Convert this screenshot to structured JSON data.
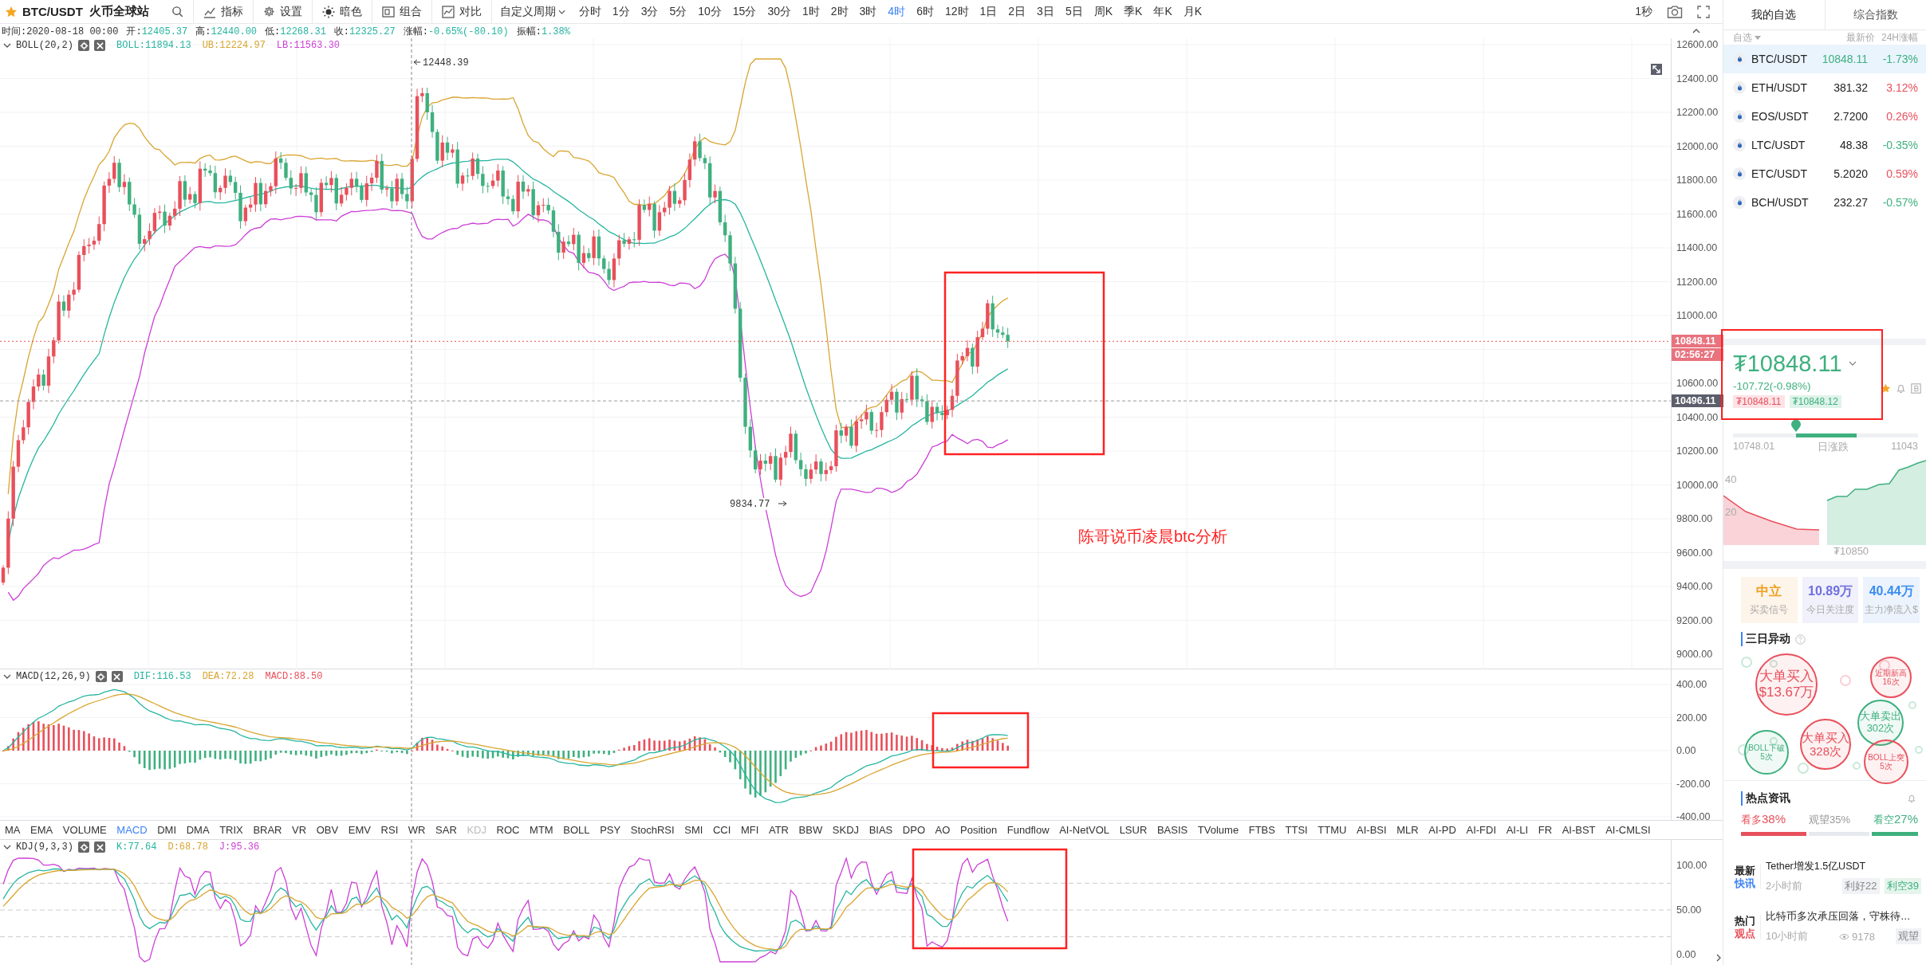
{
  "symbol": {
    "pair": "BTC/USDT",
    "exchange": "火币全球站"
  },
  "tools": [
    {
      "kind": "indicator",
      "label": "指标"
    },
    {
      "kind": "settings",
      "label": "设置"
    },
    {
      "kind": "theme",
      "label": "暗色"
    },
    {
      "kind": "layout",
      "label": "组合"
    },
    {
      "kind": "compare",
      "label": "对比"
    }
  ],
  "period_menu": "自定义周期",
  "periods": [
    {
      "label": "分时",
      "selected": false
    },
    {
      "label": "1分",
      "selected": false
    },
    {
      "label": "3分",
      "selected": false
    },
    {
      "label": "5分",
      "selected": false
    },
    {
      "label": "10分",
      "selected": false
    },
    {
      "label": "15分",
      "selected": false
    },
    {
      "label": "30分",
      "selected": false
    },
    {
      "label": "1时",
      "selected": false
    },
    {
      "label": "2时",
      "selected": false
    },
    {
      "label": "3时",
      "selected": false
    },
    {
      "label": "4时",
      "selected": true
    },
    {
      "label": "6时",
      "selected": false
    },
    {
      "label": "12时",
      "selected": false
    },
    {
      "label": "1日",
      "selected": false
    },
    {
      "label": "2日",
      "selected": false
    },
    {
      "label": "3日",
      "selected": false
    },
    {
      "label": "5日",
      "selected": false
    },
    {
      "label": "周K",
      "selected": false
    },
    {
      "label": "季K",
      "selected": false
    },
    {
      "label": "年K",
      "selected": false
    },
    {
      "label": "月K",
      "selected": false
    }
  ],
  "refresh": "1秒",
  "ohlc": [
    {
      "label": "时间:",
      "value": "2020-08-18 00:00",
      "kind": "time"
    },
    {
      "label": "开:",
      "value": "12405.37",
      "kind": "price"
    },
    {
      "label": "高:",
      "value": "12440.00",
      "kind": "price"
    },
    {
      "label": "低:",
      "value": "12268.31",
      "kind": "price"
    },
    {
      "label": "收:",
      "value": "12325.27",
      "kind": "price"
    },
    {
      "label": "涨幅:",
      "value": "-0.65%(-80.10)",
      "kind": "price"
    },
    {
      "label": "振幅:",
      "value": "1.38%",
      "kind": "price"
    }
  ],
  "main_pane": {
    "indicator": "BOLL(20,2)",
    "values": [
      {
        "label": "BOLL:11894.13",
        "color": "#26b5a0"
      },
      {
        "label": "UB:12224.97",
        "color": "#d9a530"
      },
      {
        "label": "LB:11563.30",
        "color": "#cc3fd6"
      }
    ],
    "high_label": "12448.39",
    "low_label": "9834.77",
    "axis": [
      "12600.00",
      "12400.00",
      "12200.00",
      "12000.00",
      "11800.00",
      "11600.00",
      "11400.00",
      "11200.00",
      "11000.00",
      "10600.00",
      "10400.00",
      "10200.00",
      "10000.00",
      "9800.00",
      "9600.00",
      "9400.00",
      "9200.00",
      "9000.00"
    ],
    "last_price": "10848.11",
    "countdown": "02:56:27",
    "crosshair_price": "10496.11",
    "annotation": "陈哥说币凌晨btc分析"
  },
  "macd_pane": {
    "indicator": "MACD(12,26,9)",
    "values": [
      {
        "label": "DIF:116.53",
        "color": "#26b5a0"
      },
      {
        "label": "DEA:72.28",
        "color": "#d9a530"
      },
      {
        "label": "MACD:88.50",
        "color": "#e8505b"
      }
    ],
    "axis": [
      "400.00",
      "200.00",
      "0.00",
      "-200.00",
      "-400.00"
    ]
  },
  "indicator_tabs": [
    {
      "label": "MA",
      "selected": false,
      "disabled": false
    },
    {
      "label": "EMA",
      "selected": false,
      "disabled": false
    },
    {
      "label": "VOLUME",
      "selected": false,
      "disabled": false
    },
    {
      "label": "MACD",
      "selected": true,
      "disabled": false
    },
    {
      "label": "DMI",
      "selected": false,
      "disabled": false
    },
    {
      "label": "DMA",
      "selected": false,
      "disabled": false
    },
    {
      "label": "TRIX",
      "selected": false,
      "disabled": false
    },
    {
      "label": "BRAR",
      "selected": false,
      "disabled": false
    },
    {
      "label": "VR",
      "selected": false,
      "disabled": false
    },
    {
      "label": "OBV",
      "selected": false,
      "disabled": false
    },
    {
      "label": "EMV",
      "selected": false,
      "disabled": false
    },
    {
      "label": "RSI",
      "selected": false,
      "disabled": false
    },
    {
      "label": "WR",
      "selected": false,
      "disabled": false
    },
    {
      "label": "SAR",
      "selected": false,
      "disabled": false
    },
    {
      "label": "KDJ",
      "selected": false,
      "disabled": true
    },
    {
      "label": "ROC",
      "selected": false,
      "disabled": false
    },
    {
      "label": "MTM",
      "selected": false,
      "disabled": false
    },
    {
      "label": "BOLL",
      "selected": false,
      "disabled": false
    },
    {
      "label": "PSY",
      "selected": false,
      "disabled": false
    },
    {
      "label": "StochRSI",
      "selected": false,
      "disabled": false
    },
    {
      "label": "SMI",
      "selected": false,
      "disabled": false
    },
    {
      "label": "CCI",
      "selected": false,
      "disabled": false
    },
    {
      "label": "MFI",
      "selected": false,
      "disabled": false
    },
    {
      "label": "ATR",
      "selected": false,
      "disabled": false
    },
    {
      "label": "BBW",
      "selected": false,
      "disabled": false
    },
    {
      "label": "SKDJ",
      "selected": false,
      "disabled": false
    },
    {
      "label": "BIAS",
      "selected": false,
      "disabled": false
    },
    {
      "label": "DPO",
      "selected": false,
      "disabled": false
    },
    {
      "label": "AO",
      "selected": false,
      "disabled": false
    },
    {
      "label": "Position",
      "selected": false,
      "disabled": false
    },
    {
      "label": "Fundflow",
      "selected": false,
      "disabled": false
    },
    {
      "label": "AI-NetVOL",
      "selected": false,
      "disabled": false
    },
    {
      "label": "LSUR",
      "selected": false,
      "disabled": false
    },
    {
      "label": "BASIS",
      "selected": false,
      "disabled": false
    },
    {
      "label": "TVolume",
      "selected": false,
      "disabled": false
    },
    {
      "label": "FTBS",
      "selected": false,
      "disabled": false
    },
    {
      "label": "TTSI",
      "selected": false,
      "disabled": false
    },
    {
      "label": "TTMU",
      "selected": false,
      "disabled": false
    },
    {
      "label": "AI-BSI",
      "selected": false,
      "disabled": false
    },
    {
      "label": "MLR",
      "selected": false,
      "disabled": false
    },
    {
      "label": "AI-PD",
      "selected": false,
      "disabled": false
    },
    {
      "label": "AI-FDI",
      "selected": false,
      "disabled": false
    },
    {
      "label": "AI-LI",
      "selected": false,
      "disabled": false
    },
    {
      "label": "FR",
      "selected": false,
      "disabled": false
    },
    {
      "label": "AI-BST",
      "selected": false,
      "disabled": false
    },
    {
      "label": "AI-CMLSI",
      "selected": false,
      "disabled": false
    }
  ],
  "kdj_pane": {
    "indicator": "KDJ(9,3,3)",
    "values": [
      {
        "label": "K:77.64",
        "color": "#26b5a0"
      },
      {
        "label": "D:68.78",
        "color": "#d9a530"
      },
      {
        "label": "J:95.36",
        "color": "#cc3fd6"
      }
    ],
    "axis": [
      "100.00",
      "50.00",
      "0.00"
    ]
  },
  "sidebar": {
    "tabs": [
      {
        "label": "我的自选",
        "selected": true
      },
      {
        "label": "综合指数",
        "selected": false
      }
    ],
    "columns": [
      "自选",
      "最新价",
      "24H涨幅"
    ],
    "rows": [
      {
        "pair": "BTC/USDT",
        "price": "10848.11",
        "change": "-1.73%",
        "color": "#3fb07f",
        "selected": true
      },
      {
        "pair": "ETH/USDT",
        "price": "381.32",
        "change": "3.12%",
        "color": "#e8505b",
        "selected": false
      },
      {
        "pair": "EOS/USDT",
        "price": "2.7200",
        "change": "0.26%",
        "color": "#e8505b",
        "selected": false
      },
      {
        "pair": "LTC/USDT",
        "price": "48.38",
        "change": "-0.35%",
        "color": "#3fb07f",
        "selected": false
      },
      {
        "pair": "ETC/USDT",
        "price": "5.2020",
        "change": "0.59%",
        "color": "#e8505b",
        "selected": false
      },
      {
        "pair": "BCH/USDT",
        "price": "232.27",
        "change": "-0.57%",
        "color": "#3fb07f",
        "selected": false
      }
    ],
    "ticker": {
      "price": "₮10848.11",
      "change": "-107.72(-0.98%)",
      "bid": "₮10848.11",
      "ask": "₮10848.12"
    },
    "day_range": {
      "low": "10748.01",
      "label": "日涨跌",
      "high": "11043"
    },
    "depth": {
      "yaxis": [
        "40",
        "20"
      ],
      "price": "₮10850"
    },
    "stats": [
      {
        "value": "中立",
        "label": "买卖信号",
        "color": "#f0a020"
      },
      {
        "value": "10.89万",
        "label": "今日关注度",
        "color": "#6f6fe0"
      },
      {
        "value": "40.44万",
        "label": "主力净流入$",
        "color": "#3b8ef0"
      }
    ],
    "anomalies": {
      "title": "三日异动",
      "bubbles": [
        {
          "lines": [
            "大单买入",
            "$13.67万"
          ],
          "color": "#e8505b"
        },
        {
          "lines": [
            "近期新高",
            "16次"
          ],
          "color": "#e8505b"
        },
        {
          "lines": [
            "BOLL下破",
            "5次"
          ],
          "color": "#3fb07f"
        },
        {
          "lines": [
            "大单买入",
            "328次"
          ],
          "color": "#e8505b"
        },
        {
          "lines": [
            "大单卖出",
            "302次"
          ],
          "color": "#3fb07f"
        },
        {
          "lines": [
            "BOLL上突",
            "5次"
          ],
          "color": "#e8505b"
        }
      ]
    },
    "news": {
      "title": "热点资讯",
      "sentiment": [
        {
          "label": "看多",
          "value": "38%",
          "kind": "bull"
        },
        {
          "label": "观望",
          "value": "35%",
          "kind": "neutral"
        },
        {
          "label": "看空",
          "value": "27%",
          "kind": "bear"
        }
      ],
      "items": [
        {
          "kind": "flash",
          "tag": [
            "最新",
            "快讯"
          ],
          "title": "Tether增发1.5亿USDT",
          "time": "2小时前",
          "badges": [
            {
              "label": "利好22",
              "kind": "good"
            },
            {
              "label": "利空39",
              "kind": "bad"
            }
          ]
        },
        {
          "kind": "opinion",
          "tag": [
            "热门",
            "观点"
          ],
          "title": "比特币多次承压回落，守株待…",
          "time": "10小时前",
          "views": "9178",
          "badges": [
            {
              "label": "观望",
              "kind": "neutral"
            }
          ]
        }
      ]
    }
  }
}
